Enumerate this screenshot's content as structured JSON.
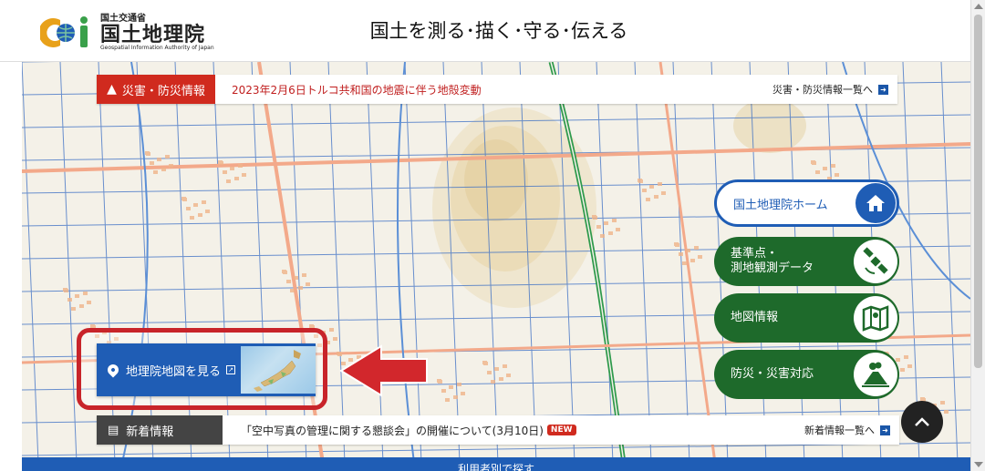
{
  "header": {
    "logo_small": "国土交通省",
    "logo_big": "国土地理院",
    "logo_en": "Geospatial Information Authority of Japan",
    "tagline": "国土を測る･描く･守る･伝える"
  },
  "disaster": {
    "tag": "災害・防災情報",
    "headline": "2023年2月6日トルコ共和国の地震に伴う地殻変動",
    "more": "災害・防災情報一覧へ"
  },
  "map_button": {
    "label": "地理院地図を見る"
  },
  "menu": {
    "home": "国土地理院ホーム",
    "items": [
      {
        "label_line1": "基準点・",
        "label_line2": "測地観測データ",
        "icon": "satellite-icon"
      },
      {
        "label_line1": "地図情報",
        "label_line2": "",
        "icon": "map-icon"
      },
      {
        "label_line1": "防災・災害対応",
        "label_line2": "",
        "icon": "volcano-icon"
      }
    ]
  },
  "news": {
    "tag": "新着情報",
    "headline": "「空中写真の管理に関する懇談会」の開催について(3月10日)",
    "badge": "NEW",
    "more": "新着情報一覧へ"
  },
  "bottom": {
    "label": "利用者別で探す"
  },
  "colors": {
    "brand_blue": "#1f5db5",
    "disaster_red": "#d02a1e",
    "menu_green": "#1e6a2b",
    "highlight_red": "#c8242a"
  }
}
